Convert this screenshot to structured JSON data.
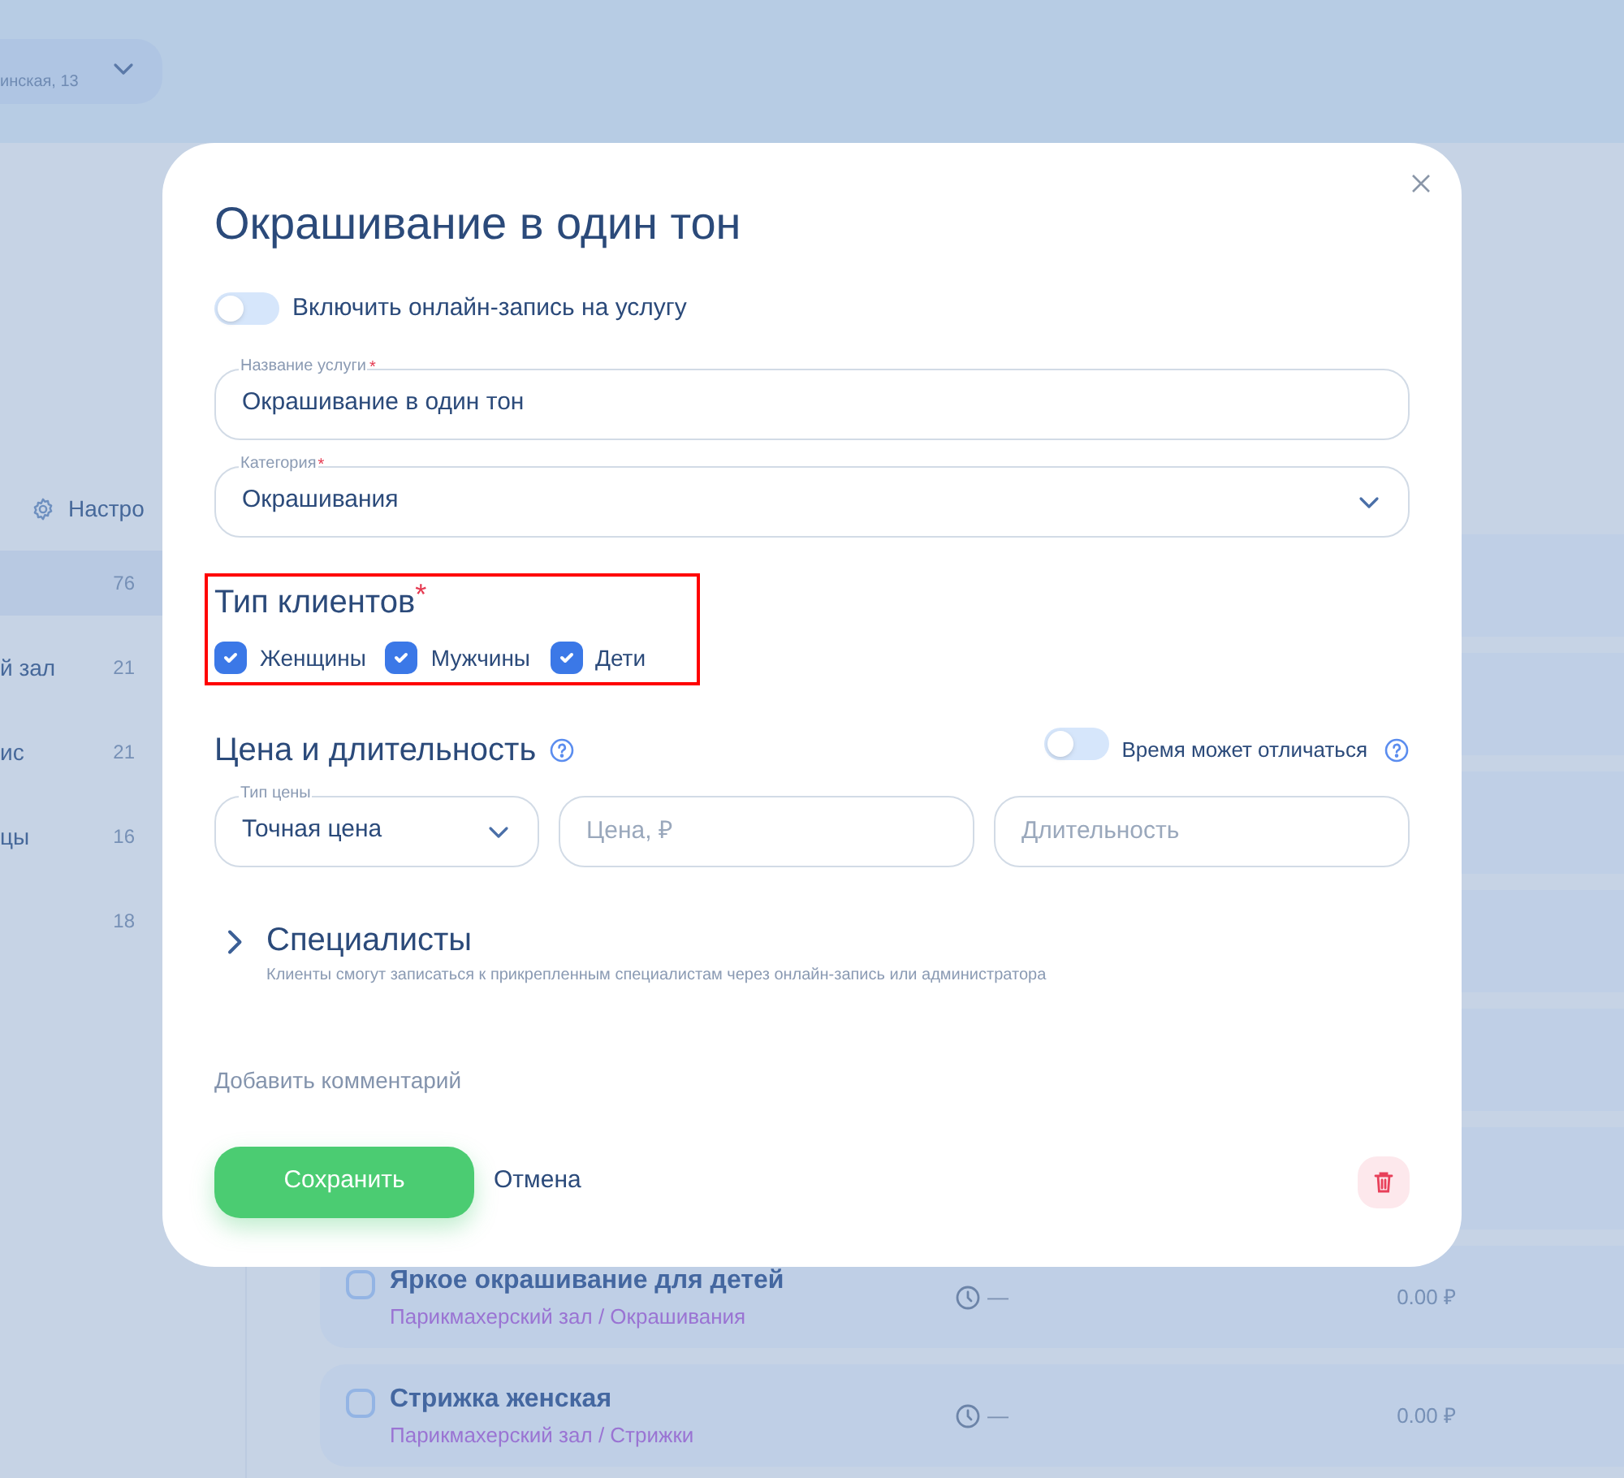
{
  "header": {
    "location": "инская, 13"
  },
  "sidebar": {
    "settings_label": "Настро",
    "items": [
      {
        "count": "76",
        "selected": true
      },
      {
        "label": "й зал",
        "count": "21",
        "selected": false
      },
      {
        "label": "ис",
        "count": "21",
        "selected": false
      },
      {
        "label": "цы",
        "count": "16",
        "selected": false
      },
      {
        "count": "18",
        "selected": false
      }
    ]
  },
  "services": [
    {
      "title": "Яркое окрашивание для детей",
      "path": "Парикмахерский зал / Окрашивания",
      "duration": "—",
      "price": "0.00 ₽",
      "checked": false
    },
    {
      "title": "Стрижка женская",
      "path": "Парикмахерский зал / Стрижки",
      "duration": "—",
      "price": "0.00 ₽",
      "checked": false
    }
  ],
  "dialog": {
    "title": "Окрашивание в один тон",
    "online_booking": {
      "label": "Включить онлайн-запись на услугу",
      "on": false
    },
    "name_field": {
      "label": "Название услуги",
      "required_mark": "*",
      "value": "Окрашивание в один тон"
    },
    "category_field": {
      "label": "Категория",
      "required_mark": "*",
      "value": "Окрашивания"
    },
    "client_types": {
      "title": "Тип клиентов",
      "required_mark": "*",
      "highlighted": true,
      "options": [
        {
          "label": "Женщины",
          "checked": true
        },
        {
          "label": "Мужчины",
          "checked": true
        },
        {
          "label": "Дети",
          "checked": true
        }
      ]
    },
    "price_section": {
      "title": "Цена и длительность",
      "time_varies": {
        "label": "Время может отличаться",
        "on": false
      },
      "price_type": {
        "label": "Тип цены",
        "value": "Точная цена"
      },
      "price": {
        "placeholder": "Цена, ₽"
      },
      "duration": {
        "placeholder": "Длительность"
      }
    },
    "specialists": {
      "title": "Специалисты",
      "expanded": false,
      "hint": "Клиенты смогут записаться к прикрепленным специалистам через онлайн-запись или администратора"
    },
    "comment_link": "Добавить комментарий",
    "save_button": "Сохранить",
    "cancel_button": "Отмена"
  }
}
